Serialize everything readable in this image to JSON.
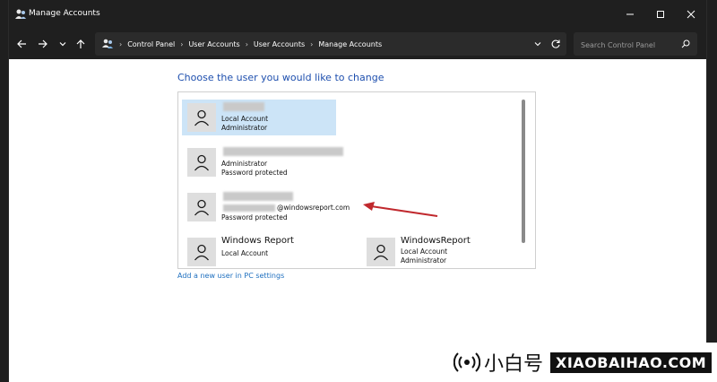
{
  "window": {
    "title": "Manage Accounts"
  },
  "addressbar": {
    "breadcrumbs": [
      "Control Panel",
      "User Accounts",
      "User Accounts",
      "Manage Accounts"
    ],
    "search_placeholder": "Search Control Panel"
  },
  "main": {
    "heading": "Choose the user you would like to change",
    "accounts": [
      {
        "name": "",
        "line1": "Local Account",
        "line2": "Administrator",
        "selected": true
      },
      {
        "name": "",
        "line1": "Administrator",
        "line2": "Password protected",
        "selected": false
      },
      {
        "name": "",
        "email_suffix": "@windowsreport.com",
        "line2": "Password protected",
        "selected": false
      },
      {
        "name": "Windows Report",
        "line1": "Local Account",
        "line2": "",
        "selected": false
      },
      {
        "name": "WindowsReport",
        "line1": "Local Account",
        "line2": "Administrator",
        "selected": false
      }
    ],
    "add_user_link": "Add a new user in PC settings"
  },
  "watermark": {
    "cn": "小白号",
    "en": "XIAOBAIHAO.COM"
  },
  "colors": {
    "accent_link": "#1e6fbf",
    "heading": "#1e4fae",
    "selected_bg": "#cce4f7",
    "annotation_arrow": "#c0282d"
  }
}
